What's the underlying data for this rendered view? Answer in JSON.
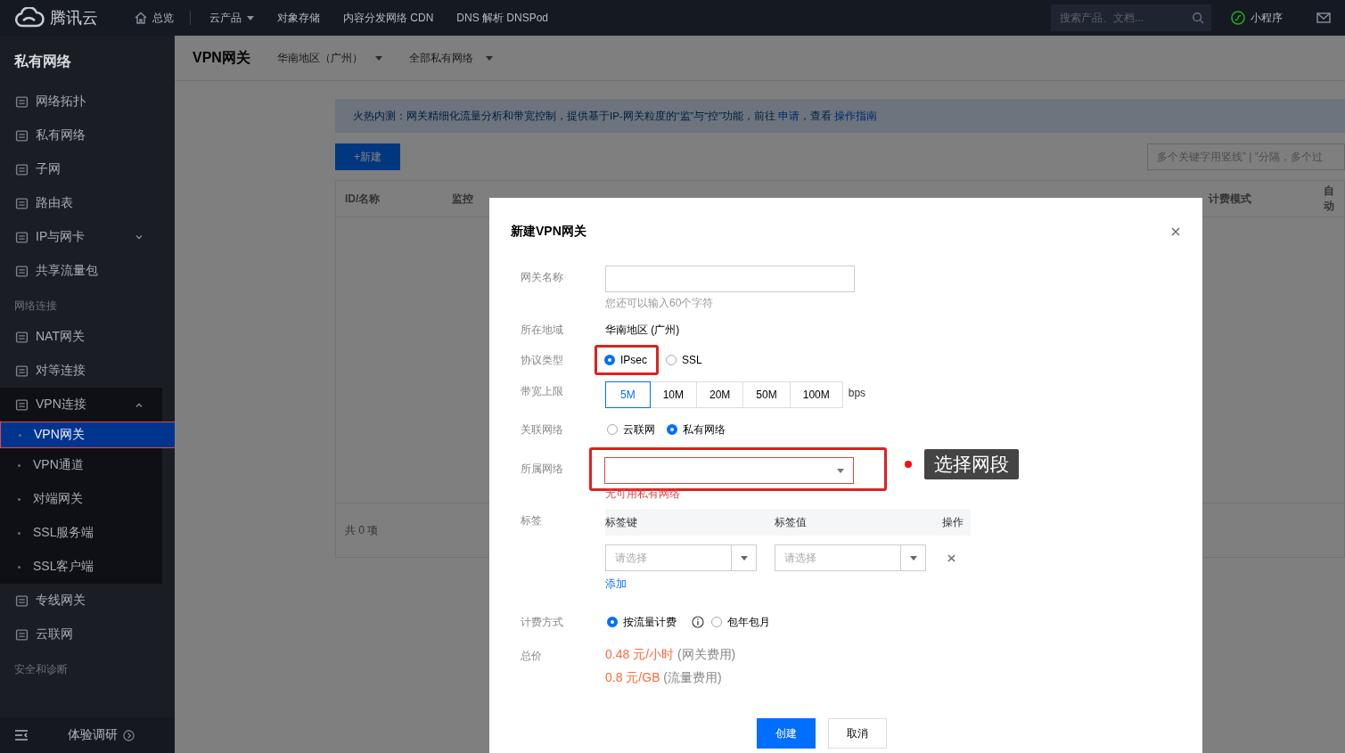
{
  "topbar": {
    "logo": "腾讯云",
    "nav": [
      {
        "label": "总览",
        "kind": "home"
      },
      {
        "label": "云产品",
        "kind": "dropdown"
      },
      {
        "label": "对象存储",
        "kind": "plain"
      },
      {
        "label": "内容分发网络 CDN",
        "kind": "plain"
      },
      {
        "label": "DNS 解析 DNSPod",
        "kind": "plain"
      }
    ],
    "search": {
      "placeholder": "搜索产品、文档..."
    },
    "miniprogram": "小程序"
  },
  "sidebar": {
    "title": "私有网络",
    "items": [
      {
        "kind": "item",
        "label": "网络拓扑",
        "selected": false
      },
      {
        "kind": "item",
        "label": "私有网络",
        "selected": false
      },
      {
        "kind": "item",
        "label": "子网",
        "selected": false
      },
      {
        "kind": "item",
        "label": "路由表",
        "selected": false
      },
      {
        "kind": "item",
        "label": "IP与网卡",
        "selected": false,
        "expanded": false
      },
      {
        "kind": "item",
        "label": "共享流量包",
        "selected": false
      },
      {
        "kind": "section",
        "label": "网络连接"
      },
      {
        "kind": "item",
        "label": "NAT网关",
        "selected": false
      },
      {
        "kind": "item",
        "label": "对等连接",
        "selected": false
      },
      {
        "kind": "item",
        "label": "VPN连接",
        "selected": false,
        "expanded": true,
        "children": [
          {
            "label": "VPN网关",
            "selected": true
          },
          {
            "label": "VPN通道",
            "selected": false
          },
          {
            "label": "对端网关",
            "selected": false
          },
          {
            "label": "SSL服务端",
            "selected": false
          },
          {
            "label": "SSL客户端",
            "selected": false
          }
        ]
      },
      {
        "kind": "item",
        "label": "专线网关",
        "selected": false
      },
      {
        "kind": "item",
        "label": "云联网",
        "selected": false
      },
      {
        "kind": "section",
        "label": "安全和诊断"
      }
    ],
    "footer": "体验调研"
  },
  "header": {
    "title": "VPN网关",
    "filters": [
      "华南地区（广州）",
      "全部私有网络"
    ]
  },
  "notice": [
    {
      "text": "火热内测：网关精细化流量分析和带宽控制，提供基于IP-网关粒度的“监”与“控”功能，前往 ",
      "link": false
    },
    {
      "text": "申请",
      "link": true
    },
    {
      "text": "，查看 ",
      "link": false
    },
    {
      "text": "操作指南",
      "link": true
    }
  ],
  "new_button": "+新建",
  "filter_search": {
    "placeholder": "多个关键字用竖线” | ”分隔，多个过"
  },
  "table": {
    "columns": [
      "ID/名称",
      "监控",
      "计费模式",
      "自动"
    ],
    "total": "共 0 项"
  },
  "dialog": {
    "title": "新建VPN网关",
    "fields": [
      {
        "kind": "input",
        "label": "网关名称",
        "hint": "您还可以输入60个字符"
      },
      {
        "kind": "text",
        "label": "所在地域",
        "value": "华南地区 (广州)"
      },
      {
        "kind": "radio",
        "label": "协议类型",
        "options": [
          {
            "label": "IPsec",
            "selected": true,
            "highlighted": true
          },
          {
            "label": "SSL",
            "selected": false,
            "highlighted": false
          }
        ]
      },
      {
        "kind": "segments",
        "label": "带宽上限",
        "options": [
          {
            "label": "5M",
            "selected": true
          },
          {
            "label": "10M",
            "selected": false
          },
          {
            "label": "20M",
            "selected": false
          },
          {
            "label": "50M",
            "selected": false
          },
          {
            "label": "100M",
            "selected": false
          }
        ],
        "unit": "bps"
      },
      {
        "kind": "radio",
        "label": "关联网络",
        "options": [
          {
            "label": "云联网",
            "selected": false,
            "highlighted": false
          },
          {
            "label": "私有网络",
            "selected": true,
            "highlighted": false
          }
        ]
      },
      {
        "kind": "select",
        "label": "所属网络",
        "error": "无可用私有网络",
        "highlighted": true,
        "callout": "选择网段"
      },
      {
        "kind": "tags",
        "label": "标签",
        "columns": [
          "标签键",
          "标签值",
          "操作"
        ],
        "rows": [
          {
            "key_placeholder": "请选择",
            "value_placeholder": "请选择"
          }
        ],
        "add": "添加"
      },
      {
        "kind": "billing",
        "label": "计费方式",
        "options": [
          {
            "label": "按流量计费",
            "selected": true,
            "info": true
          },
          {
            "label": "包年包月",
            "selected": false,
            "info": false
          }
        ]
      },
      {
        "kind": "price",
        "label": "总价",
        "lines": [
          {
            "price": "0.48 元/小时",
            "note": "(网关费用)"
          },
          {
            "price": "0.8 元/GB",
            "note": "(流量费用)"
          }
        ]
      }
    ],
    "buttons": [
      {
        "label": "创建",
        "primary": true
      },
      {
        "label": "取消",
        "primary": false
      }
    ]
  }
}
